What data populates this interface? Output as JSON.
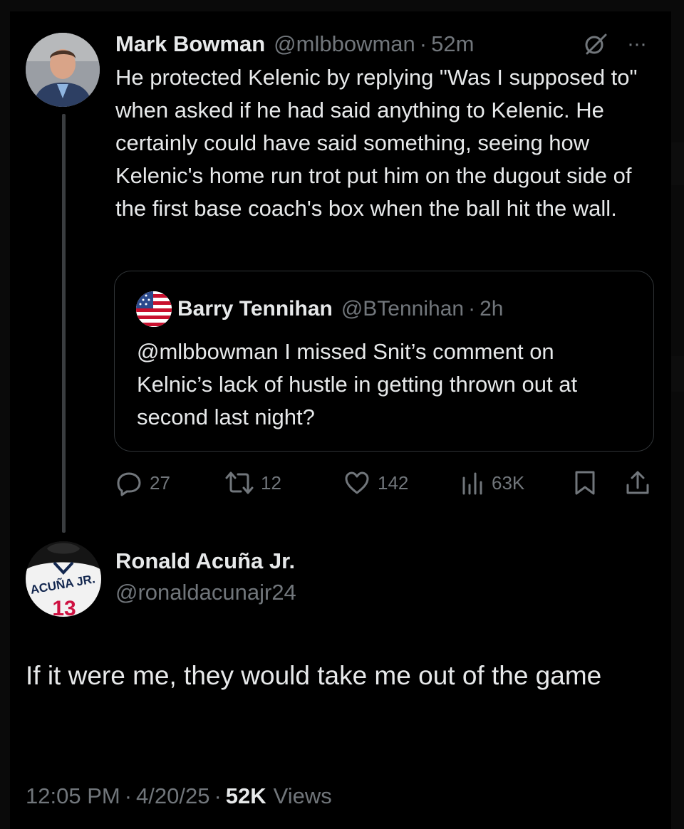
{
  "parent_tweet": {
    "author_name": "Mark Bowman",
    "author_handle": "@mlbbowman",
    "separator": "·",
    "time": "52m",
    "more_label": "···",
    "text": "He protected Kelenic by replying \"Was I supposed to\" when asked if he had said anything to Kelenic.  He certainly could have said something, seeing how Kelenic's home run trot put him on the dugout side of the first base coach's box when the ball hit the wall.",
    "quote": {
      "author_name": "Barry Tennihan",
      "author_handle": "@BTennihan",
      "separator": "·",
      "time": "2h",
      "text": "@mlbbowman I missed Snit’s comment on Kelnic’s lack of hustle in getting thrown out at second last night?"
    },
    "actions": {
      "replies": "27",
      "reposts": "12",
      "likes": "142",
      "views": "63K"
    }
  },
  "reply_tweet": {
    "author_name": "Ronald Acuña Jr.",
    "author_handle": "@ronaldacunajr24",
    "avatar_jersey_text": "ACUÑA JR.",
    "text": "If it were me, they would take me out of the game",
    "time": "12:05 PM",
    "separator": "·",
    "date": "4/20/25",
    "separator2": "·",
    "views_count": "52K",
    "views_label": "Views"
  },
  "colors": {
    "background": "#000000",
    "text_primary": "#e7e9ea",
    "text_muted": "#71767b",
    "border": "#2f3336"
  }
}
